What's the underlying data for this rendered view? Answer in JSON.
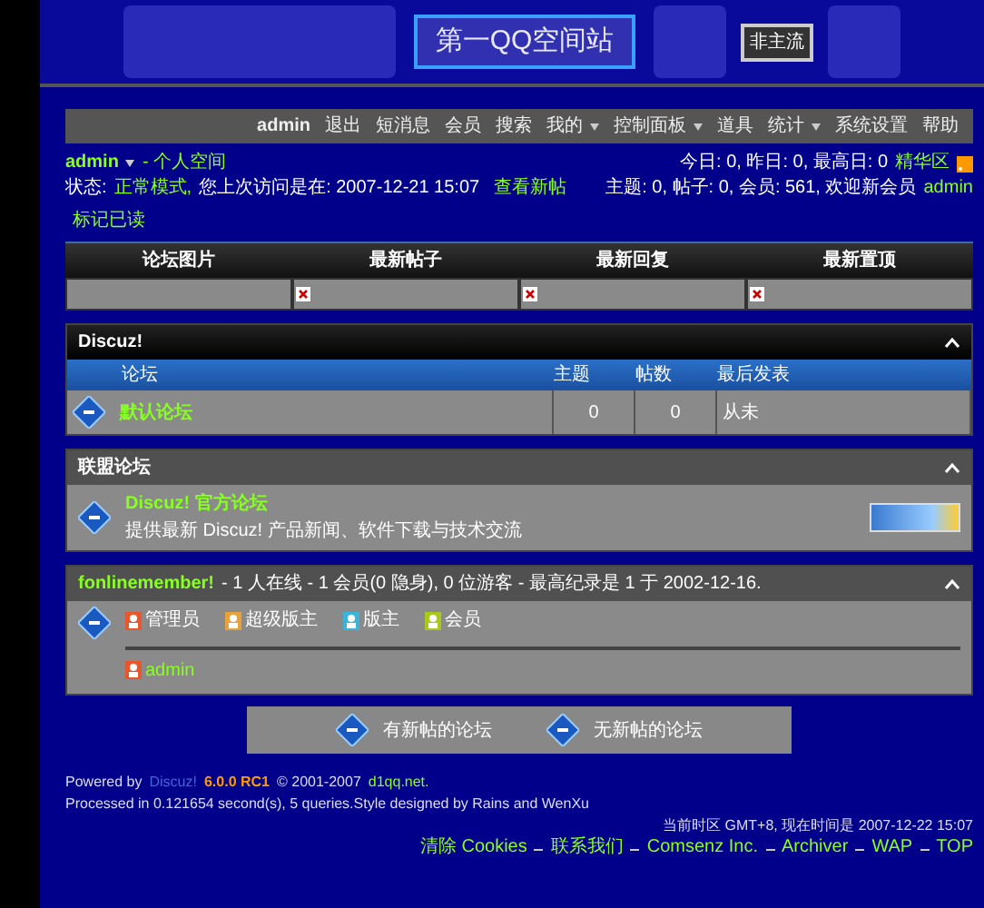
{
  "header": {
    "logo": "第一QQ空间站",
    "sign": "非主流"
  },
  "nav": {
    "user": "admin",
    "items": [
      {
        "label": "退出",
        "dropdown": false
      },
      {
        "label": "短消息",
        "dropdown": false
      },
      {
        "label": "会员",
        "dropdown": false
      },
      {
        "label": "搜索",
        "dropdown": false
      },
      {
        "label": "我的",
        "dropdown": true
      },
      {
        "label": "控制面板",
        "dropdown": true
      },
      {
        "label": "道具",
        "dropdown": false
      },
      {
        "label": "统计",
        "dropdown": true
      },
      {
        "label": "系统设置",
        "dropdown": false
      },
      {
        "label": "帮助",
        "dropdown": false
      }
    ]
  },
  "user_info": {
    "name": "admin",
    "menu": true,
    "space": "- 个人空间",
    "status_label": "状态:",
    "mode": "正常模式,",
    "last_visit": "您上次访问是在: 2007-12-21 15:07",
    "links": [
      "查看新帖",
      "标记已读"
    ],
    "today": "今日: 0, 昨日: 0, 最高日: 0",
    "digest": "精华区",
    "totals": "主题: 0, 帖子: 0, 会员: 561, 欢迎新会员",
    "newest_member": "admin"
  },
  "tabs": [
    {
      "label": "论坛图片",
      "broken_image": false
    },
    {
      "label": "最新帖子",
      "broken_image": true
    },
    {
      "label": "最新回复",
      "broken_image": true
    },
    {
      "label": "最新置顶",
      "broken_image": true
    }
  ],
  "categories": [
    {
      "title": "Discuz!",
      "kind": "table",
      "columns": [
        "论坛",
        "主题",
        "帖数",
        "最后发表"
      ],
      "rows": [
        {
          "name": "默认论坛",
          "topics": "0",
          "posts": "0",
          "last_post": "从未"
        }
      ]
    },
    {
      "title": "联盟论坛",
      "kind": "links",
      "links": [
        {
          "name": "Discuz! 官方论坛",
          "description": "提供最新 Discuz! 产品新闻、软件下载与技术交流"
        }
      ]
    }
  ],
  "online": {
    "title": "fonlinemember!",
    "summary": "- 1 人在线 - 1 会员(0 隐身), 0 位游客 - 最高纪录是 1 于 2002-12-16.",
    "legend": [
      {
        "label": "管理员",
        "color": "#e8572c"
      },
      {
        "label": "超级版主",
        "color": "#e8a23c"
      },
      {
        "label": "版主",
        "color": "#3cb4d8"
      },
      {
        "label": "会员",
        "color": "#a8c81c"
      }
    ],
    "users": [
      {
        "name": "admin",
        "color": "#e8572c"
      }
    ]
  },
  "legend": [
    "有新帖的论坛",
    "无新帖的论坛"
  ],
  "footer": {
    "powered": "Powered by",
    "brand": "Discuz!",
    "version": "6.0.0 RC1",
    "copyright": "© 2001-2007",
    "site": "d1qq.net.",
    "processed": "Processed in 0.121654 second(s), 5 queries.Style designed by Rains and WenXu",
    "timezone": "当前时区 GMT+8, 现在时间是 2007-12-22 15:07",
    "links": [
      "清除 Cookies",
      "联系我们",
      "Comsenz Inc.",
      "Archiver",
      "WAP",
      "TOP"
    ]
  }
}
